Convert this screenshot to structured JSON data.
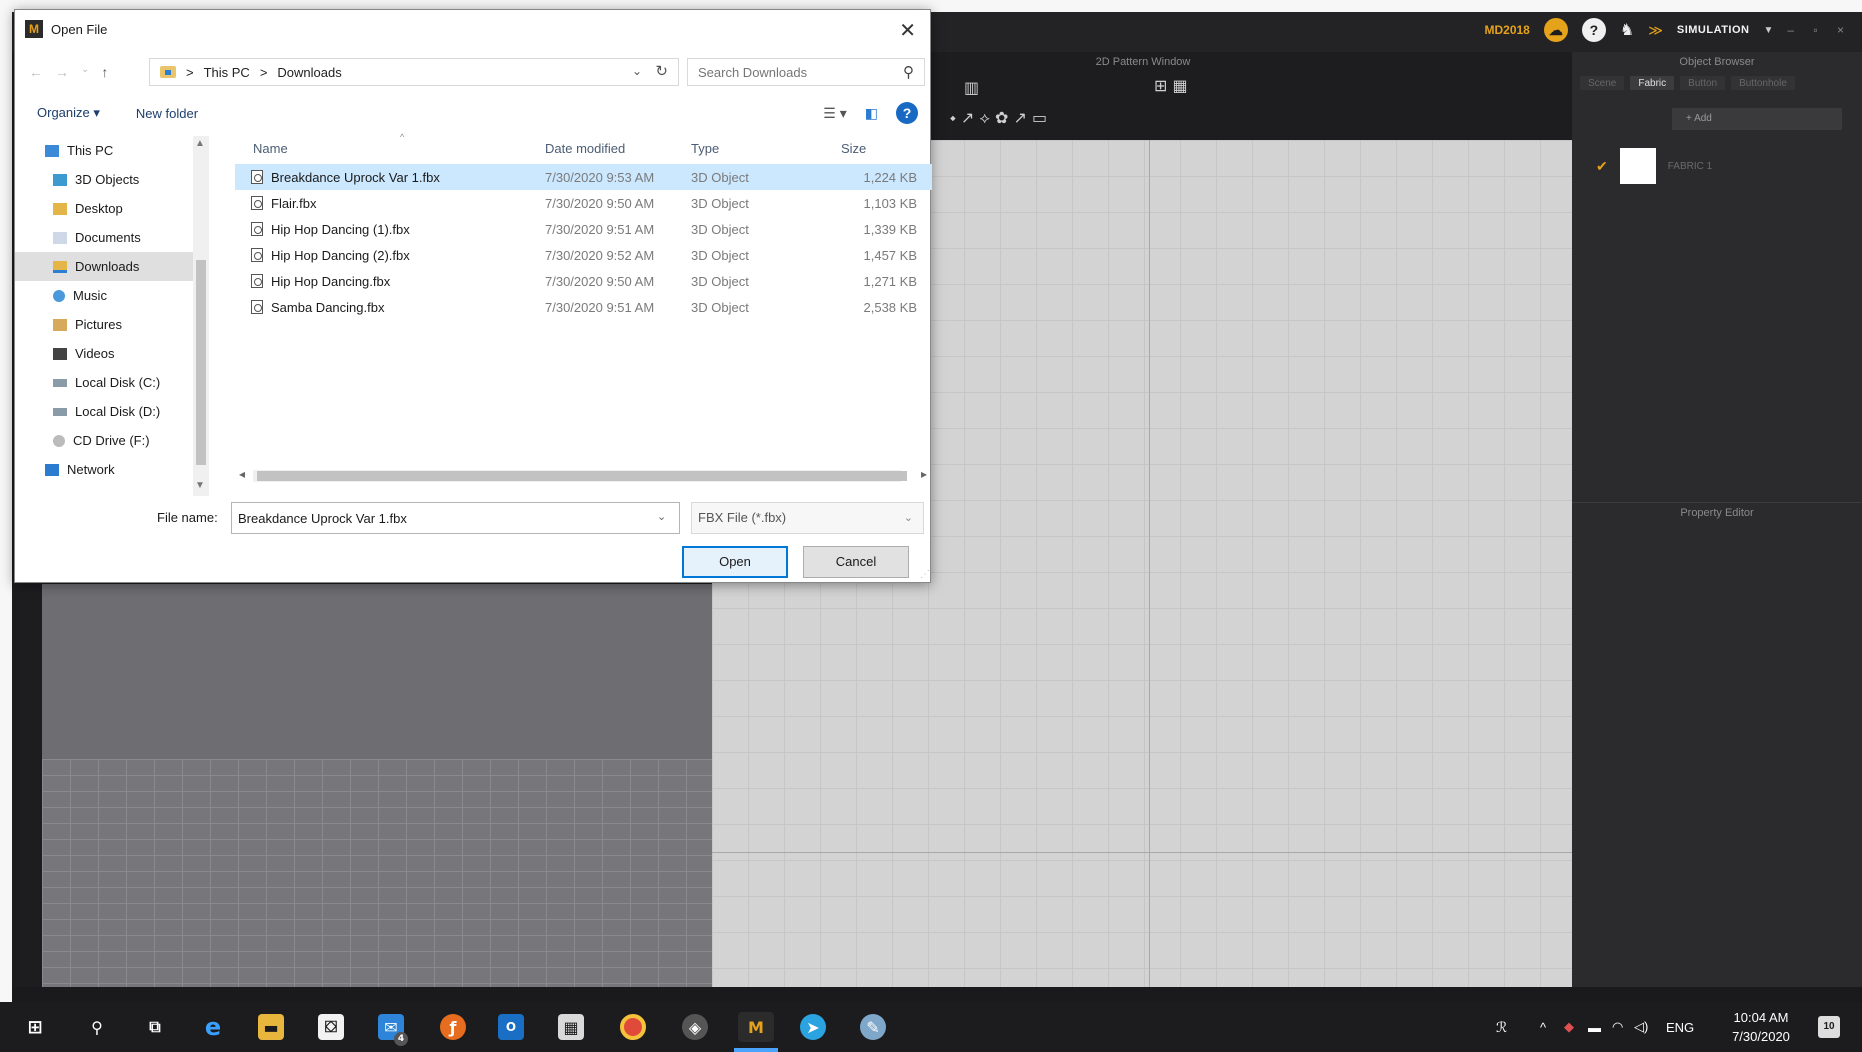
{
  "dialog": {
    "title": "Open File",
    "address": {
      "crumbs": [
        "This PC",
        "Downloads"
      ],
      "separator": ">"
    },
    "search_placeholder": "Search Downloads",
    "commands": {
      "organize": "Organize ▾",
      "new_folder": "New folder"
    },
    "nav_items": [
      {
        "label": "This PC",
        "icon": "pc-icon"
      },
      {
        "label": "3D Objects",
        "icon": "3d-objects-icon"
      },
      {
        "label": "Desktop",
        "icon": "desktop-folder-icon"
      },
      {
        "label": "Documents",
        "icon": "documents-icon"
      },
      {
        "label": "Downloads",
        "icon": "downloads-icon"
      },
      {
        "label": "Music",
        "icon": "music-icon"
      },
      {
        "label": "Pictures",
        "icon": "pictures-icon"
      },
      {
        "label": "Videos",
        "icon": "videos-icon"
      },
      {
        "label": "Local Disk (C:)",
        "icon": "disk-icon"
      },
      {
        "label": "Local Disk (D:)",
        "icon": "disk-icon"
      },
      {
        "label": "CD Drive (F:)",
        "icon": "cd-drive-icon"
      },
      {
        "label": "Network",
        "icon": "network-icon"
      }
    ],
    "columns": {
      "name": "Name",
      "date": "Date modified",
      "type": "Type",
      "size": "Size"
    },
    "files": [
      {
        "name": "Breakdance Uprock Var 1.fbx",
        "date": "7/30/2020 9:53 AM",
        "type": "3D Object",
        "size": "1,224 KB"
      },
      {
        "name": "Flair.fbx",
        "date": "7/30/2020 9:50 AM",
        "type": "3D Object",
        "size": "1,103 KB"
      },
      {
        "name": "Hip Hop Dancing (1).fbx",
        "date": "7/30/2020 9:51 AM",
        "type": "3D Object",
        "size": "1,339 KB"
      },
      {
        "name": "Hip Hop Dancing (2).fbx",
        "date": "7/30/2020 9:52 AM",
        "type": "3D Object",
        "size": "1,457 KB"
      },
      {
        "name": "Hip Hop Dancing.fbx",
        "date": "7/30/2020 9:50 AM",
        "type": "3D Object",
        "size": "1,271 KB"
      },
      {
        "name": "Samba Dancing.fbx",
        "date": "7/30/2020 9:51 AM",
        "type": "3D Object",
        "size": "2,538 KB"
      }
    ],
    "selected_file_index": 0,
    "file_name_label": "File name:",
    "file_name_value": "Breakdance Uprock Var 1.fbx",
    "file_type_filter": "FBX File (*.fbx)",
    "open_label": "Open",
    "cancel_label": "Cancel"
  },
  "app": {
    "version_badge": "MD2018",
    "mode_label": "SIMULATION",
    "pattern_window_title": "2D Pattern Window",
    "object_browser_title": "Object Browser",
    "object_browser_tabs": [
      "Scene",
      "Fabric",
      "Button",
      "Buttonhole"
    ],
    "object_browser_active_tab": "Fabric",
    "add_label": "+ Add",
    "fabric_name": "FABRIC 1",
    "property_editor_title": "Property Editor",
    "accent_color": "#e5a21b"
  },
  "taskbar": {
    "apps": [
      "windows-start",
      "search",
      "task-view",
      "edge",
      "file-explorer",
      "store",
      "mail",
      "firefox",
      "outlook",
      "calculator",
      "chrome",
      "cube-app",
      "marvelous-designer",
      "telegram",
      "paint-app"
    ],
    "active_app": "marvelous-designer",
    "mail_badge": "4",
    "language": "ENG",
    "time": "10:04 AM",
    "date": "7/30/2020",
    "notification_count": "10"
  }
}
